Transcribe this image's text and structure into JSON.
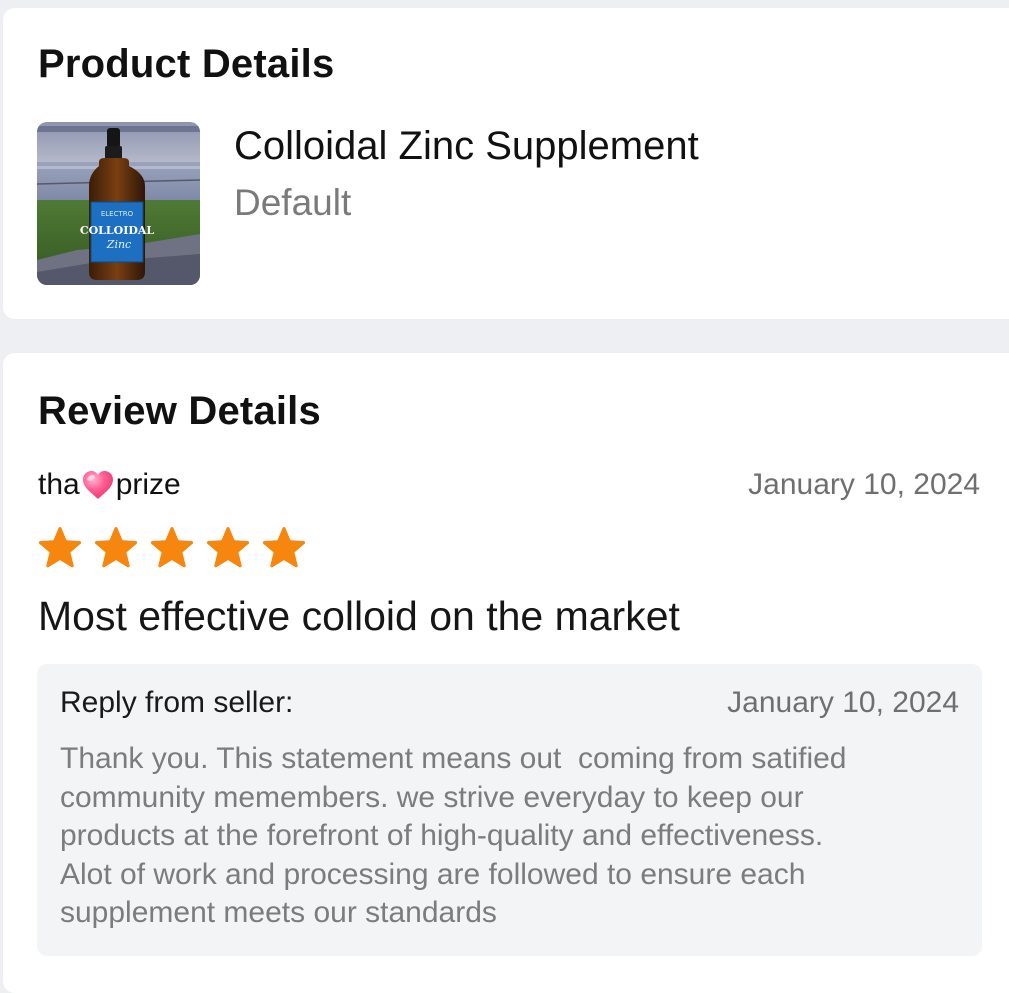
{
  "product_details": {
    "title": "Product Details",
    "product": {
      "name": "Colloidal Zinc Supplement",
      "variant": "Default",
      "image_label_top": "ELECTRO",
      "image_label_main": "COLLOIDAL",
      "image_label_sub": "Zinc"
    }
  },
  "review_details": {
    "title": "Review Details",
    "reviewer": {
      "name_before": "tha",
      "name_after": "prize",
      "emoji_icon": "pink-heart-icon"
    },
    "date": "January 10, 2024",
    "rating": 5,
    "rating_max": 5,
    "star_color": "#f7860f",
    "review_title": "Most effective colloid on the market",
    "reply": {
      "label": "Reply from seller:",
      "date": "January 10, 2024",
      "lines": [
        "Thank you. This statement means out  coming from satified",
        "community memembers. we strive everyday to keep our",
        "products at the forefront of high-quality and effectiveness.",
        "Alot of work and processing are followed to ensure each",
        "supplement meets our standards"
      ]
    }
  }
}
